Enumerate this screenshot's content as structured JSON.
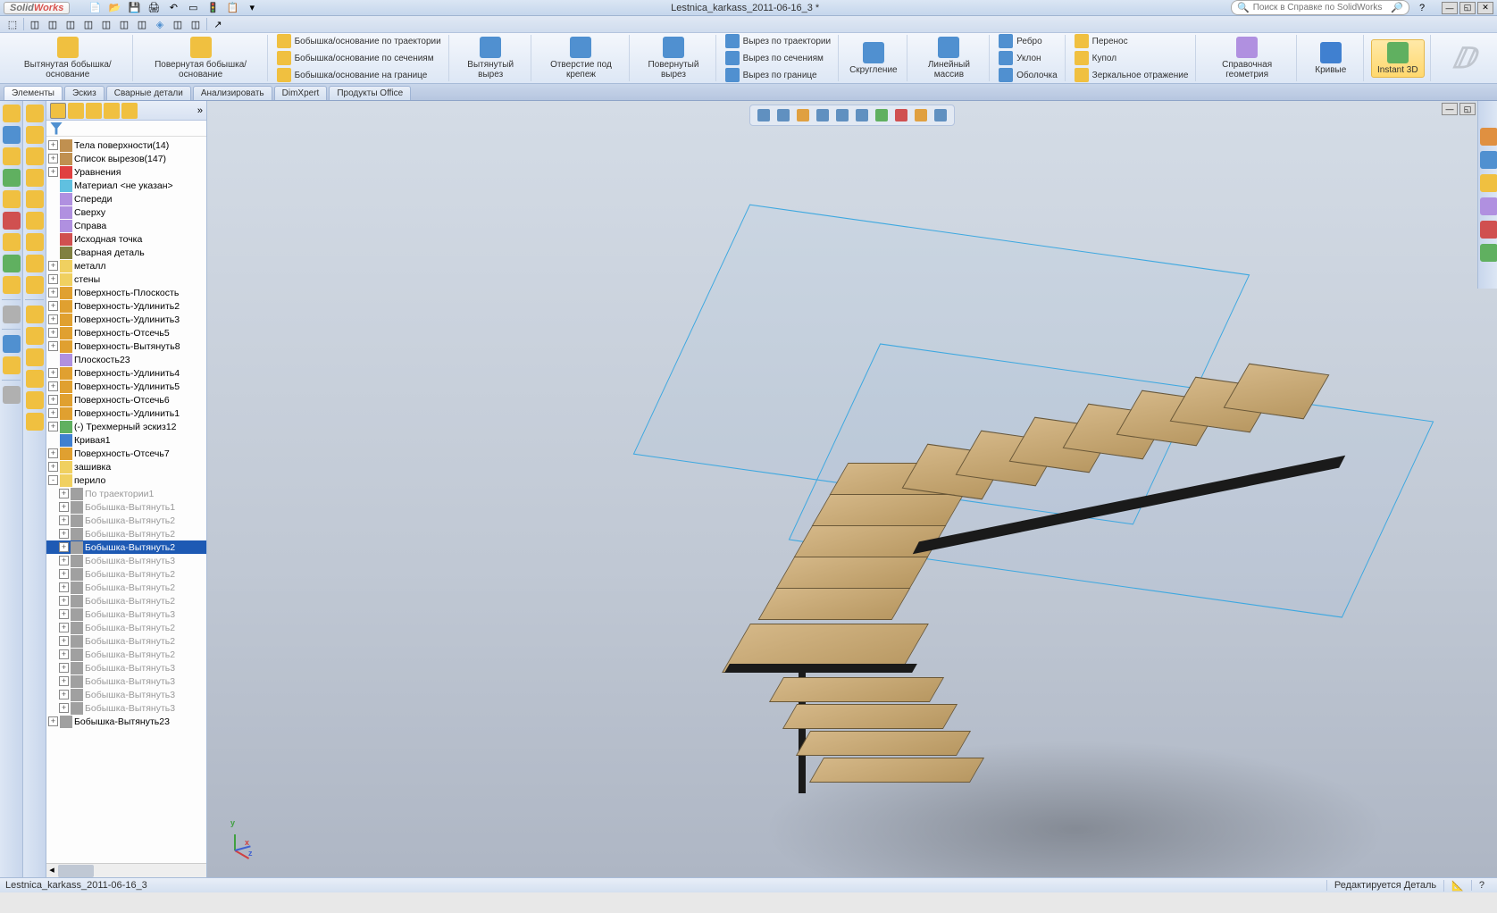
{
  "app_name": "SolidWorks",
  "document_title": "Lestnica_karkass_2011-06-16_3 *",
  "search_placeholder": "Поиск в Справке по SolidWorks",
  "ribbon": {
    "extrude_boss": "Вытянутая\nбобышка/основание",
    "revolve_boss": "Повернутая\nбобышка/основание",
    "swept_boss": "Бобышка/основание по траектории",
    "loft_boss": "Бобышка/основание по сечениям",
    "boundary_boss": "Бобышка/основание на границе",
    "extrude_cut": "Вытянутый\nвырез",
    "hole": "Отверстие\nпод\nкрепеж",
    "revolve_cut": "Повернутый\nвырез",
    "swept_cut": "Вырез по траектории",
    "loft_cut": "Вырез по сечениям",
    "boundary_cut": "Вырез по границе",
    "fillet": "Скругление",
    "pattern": "Линейный\nмассив",
    "rib": "Ребро",
    "draft": "Уклон",
    "shell": "Оболочка",
    "wrap": "Перенос",
    "dome": "Купол",
    "mirror": "Зеркальное отражение",
    "refgeom": "Справочная\nгеометрия",
    "curves": "Кривые",
    "instant3d": "Instant\n3D"
  },
  "tabs": [
    "Элементы",
    "Эскиз",
    "Сварные детали",
    "Анализировать",
    "DimXpert",
    "Продукты Office"
  ],
  "active_tab": 0,
  "tree": [
    {
      "exp": "+",
      "ico": "body",
      "lbl": "Тела поверхности(14)",
      "ind": 0
    },
    {
      "exp": "+",
      "ico": "body",
      "lbl": "Список вырезов(147)",
      "ind": 0
    },
    {
      "exp": "+",
      "ico": "eq",
      "lbl": "Уравнения",
      "ind": 0
    },
    {
      "exp": "",
      "ico": "mat",
      "lbl": "Материал <не указан>",
      "ind": 0
    },
    {
      "exp": "",
      "ico": "plane",
      "lbl": "Спереди",
      "ind": 0
    },
    {
      "exp": "",
      "ico": "plane",
      "lbl": "Сверху",
      "ind": 0
    },
    {
      "exp": "",
      "ico": "plane",
      "lbl": "Справа",
      "ind": 0
    },
    {
      "exp": "",
      "ico": "origin",
      "lbl": "Исходная точка",
      "ind": 0
    },
    {
      "exp": "",
      "ico": "weld",
      "lbl": "Сварная деталь",
      "ind": 0
    },
    {
      "exp": "+",
      "ico": "folder",
      "lbl": "металл",
      "ind": 0
    },
    {
      "exp": "+",
      "ico": "folder",
      "lbl": "стены",
      "ind": 0
    },
    {
      "exp": "+",
      "ico": "surf",
      "lbl": "Поверхность-Плоскость",
      "ind": 0
    },
    {
      "exp": "+",
      "ico": "surf",
      "lbl": "Поверхность-Удлинить2",
      "ind": 0
    },
    {
      "exp": "+",
      "ico": "surf",
      "lbl": "Поверхность-Удлинить3",
      "ind": 0
    },
    {
      "exp": "+",
      "ico": "surf",
      "lbl": "Поверхность-Отсечь5",
      "ind": 0
    },
    {
      "exp": "+",
      "ico": "surf",
      "lbl": "Поверхность-Вытянуть8",
      "ind": 0
    },
    {
      "exp": "",
      "ico": "plane",
      "lbl": "Плоскость23",
      "ind": 0
    },
    {
      "exp": "+",
      "ico": "surf",
      "lbl": "Поверхность-Удлинить4",
      "ind": 0
    },
    {
      "exp": "+",
      "ico": "surf",
      "lbl": "Поверхность-Удлинить5",
      "ind": 0
    },
    {
      "exp": "+",
      "ico": "surf",
      "lbl": "Поверхность-Отсечь6",
      "ind": 0
    },
    {
      "exp": "+",
      "ico": "surf",
      "lbl": "Поверхность-Удлинить1",
      "ind": 0
    },
    {
      "exp": "+",
      "ico": "sketch",
      "lbl": "(-) Трехмерный эскиз12",
      "ind": 0
    },
    {
      "exp": "",
      "ico": "curve",
      "lbl": "Кривая1",
      "ind": 0
    },
    {
      "exp": "+",
      "ico": "surf",
      "lbl": "Поверхность-Отсечь7",
      "ind": 0
    },
    {
      "exp": "+",
      "ico": "folder",
      "lbl": "зашивка",
      "ind": 0
    },
    {
      "exp": "-",
      "ico": "folder",
      "lbl": "перило",
      "ind": 0
    },
    {
      "exp": "+",
      "ico": "feat",
      "lbl": "По траектории1",
      "ind": 1,
      "gray": true
    },
    {
      "exp": "+",
      "ico": "feat",
      "lbl": "Бобышка-Вытянуть1",
      "ind": 1,
      "gray": true
    },
    {
      "exp": "+",
      "ico": "feat",
      "lbl": "Бобышка-Вытянуть2",
      "ind": 1,
      "gray": true
    },
    {
      "exp": "+",
      "ico": "feat",
      "lbl": "Бобышка-Вытянуть2",
      "ind": 1,
      "gray": true
    },
    {
      "exp": "+",
      "ico": "feat",
      "lbl": "Бобышка-Вытянуть2",
      "ind": 1,
      "sel": true
    },
    {
      "exp": "+",
      "ico": "feat",
      "lbl": "Бобышка-Вытянуть3",
      "ind": 1,
      "gray": true
    },
    {
      "exp": "+",
      "ico": "feat",
      "lbl": "Бобышка-Вытянуть2",
      "ind": 1,
      "gray": true
    },
    {
      "exp": "+",
      "ico": "feat",
      "lbl": "Бобышка-Вытянуть2",
      "ind": 1,
      "gray": true
    },
    {
      "exp": "+",
      "ico": "feat",
      "lbl": "Бобышка-Вытянуть2",
      "ind": 1,
      "gray": true
    },
    {
      "exp": "+",
      "ico": "feat",
      "lbl": "Бобышка-Вытянуть3",
      "ind": 1,
      "gray": true
    },
    {
      "exp": "+",
      "ico": "feat",
      "lbl": "Бобышка-Вытянуть2",
      "ind": 1,
      "gray": true
    },
    {
      "exp": "+",
      "ico": "feat",
      "lbl": "Бобышка-Вытянуть2",
      "ind": 1,
      "gray": true
    },
    {
      "exp": "+",
      "ico": "feat",
      "lbl": "Бобышка-Вытянуть2",
      "ind": 1,
      "gray": true
    },
    {
      "exp": "+",
      "ico": "feat",
      "lbl": "Бобышка-Вытянуть3",
      "ind": 1,
      "gray": true
    },
    {
      "exp": "+",
      "ico": "feat",
      "lbl": "Бобышка-Вытянуть3",
      "ind": 1,
      "gray": true
    },
    {
      "exp": "+",
      "ico": "feat",
      "lbl": "Бобышка-Вытянуть3",
      "ind": 1,
      "gray": true
    },
    {
      "exp": "+",
      "ico": "feat",
      "lbl": "Бобышка-Вытянуть3",
      "ind": 1,
      "gray": true
    },
    {
      "exp": "+",
      "ico": "feat",
      "lbl": "Бобышка-Вытянуть23",
      "ind": 0
    }
  ],
  "status": {
    "doc": "Lestnica_karkass_2011-06-16_3",
    "mode": "Редактируется Деталь"
  },
  "triad": {
    "x": "x",
    "y": "y",
    "z": "z"
  }
}
